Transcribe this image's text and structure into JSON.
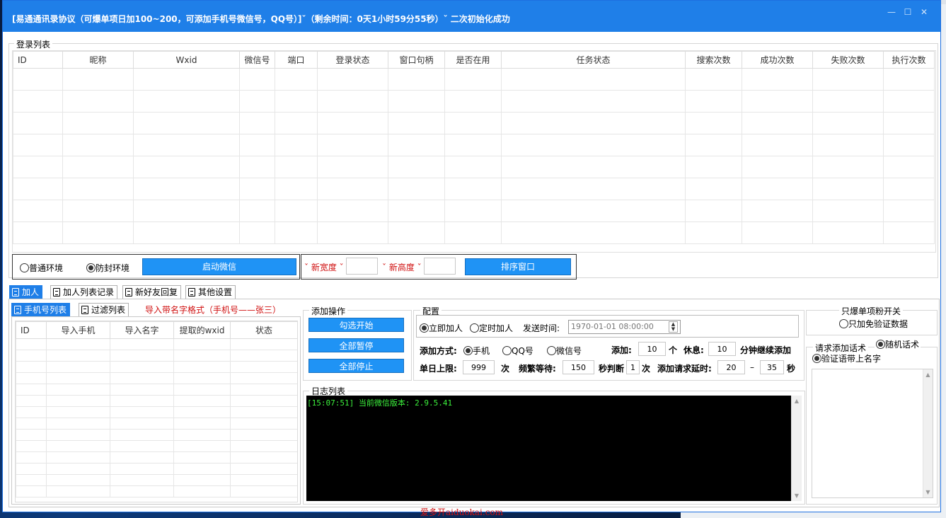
{
  "window": {
    "title": "[易通通讯录协议（可爆单项日加100~200，可添加手机号微信号，QQ号）]ˇ（剩余时间：0天1小时59分55秒）ˇ 二次初始化成功",
    "btn_min": "—",
    "btn_max": "☐",
    "btn_close": "✕"
  },
  "login_list": {
    "label": "登录列表",
    "columns": [
      "ID",
      "昵称",
      "Wxid",
      "微信号",
      "端口",
      "登录状态",
      "窗口句柄",
      "是否在用",
      "任务状态",
      "搜索次数",
      "成功次数",
      "失败次数",
      "执行次数"
    ]
  },
  "env": {
    "normal": "普通环境",
    "anti_ban": "防封环境",
    "start_wechat": "启动微信"
  },
  "size": {
    "new_width": "ˇ 新宽度 ˇ",
    "new_height": "ˇ 新高度 ˇ",
    "sort_windows": "排序窗口"
  },
  "main_tabs": [
    "加人",
    "加人列表记录",
    "新好友回复",
    "其他设置"
  ],
  "sub_tabs": [
    "手机号列表",
    "过滤列表"
  ],
  "import_hint": "导入带名字格式（手机号——张三）",
  "phone_list": {
    "columns": [
      "ID",
      "导入手机",
      "导入名字",
      "提取的wxid",
      "状态"
    ]
  },
  "ops": {
    "label": "添加操作",
    "check_start": "勾选开始",
    "pause_all": "全部暂停",
    "stop_all": "全部停止"
  },
  "config": {
    "label": "配置",
    "immediate": "立即加人",
    "timed": "定时加人",
    "send_time_label": "发送时间:",
    "send_time": "1970-01-01 08:00:00",
    "add_mode_label": "添加方式:",
    "mode_phone": "手机",
    "mode_qq": "QQ号",
    "mode_wechat": "微信号",
    "add_label": "添加:",
    "add_value": "10",
    "add_unit": "个",
    "rest_label": "休息:",
    "rest_value": "10",
    "rest_unit": "分钟继续添加",
    "daily_label": "单日上限:",
    "daily_value": "999",
    "daily_unit": "次",
    "freq_label": "频繁等待:",
    "freq_value": "150",
    "freq_unit": "秒判断",
    "judge_value": "1",
    "judge_unit": "次",
    "delay_label": "添加请求延时:",
    "delay_min": "20",
    "delay_sep": "–",
    "delay_max": "35",
    "delay_unit": "秒"
  },
  "log": {
    "label": "日志列表",
    "line": "[15:07:51] 当前微信版本: 2.9.5.41"
  },
  "switch": {
    "label": "只爆单项粉开关",
    "verify_only": "只加免验证数据"
  },
  "request": {
    "label": "请求添加话术",
    "random": "随机话术",
    "with_name": "验证语带上名字"
  },
  "watermark": "爱多开aiduokai.com",
  "colors": {
    "title_bar": "#1f7fe8",
    "button": "#1f93f5",
    "log_text": "#3cf03c",
    "hint": "#d01010"
  }
}
